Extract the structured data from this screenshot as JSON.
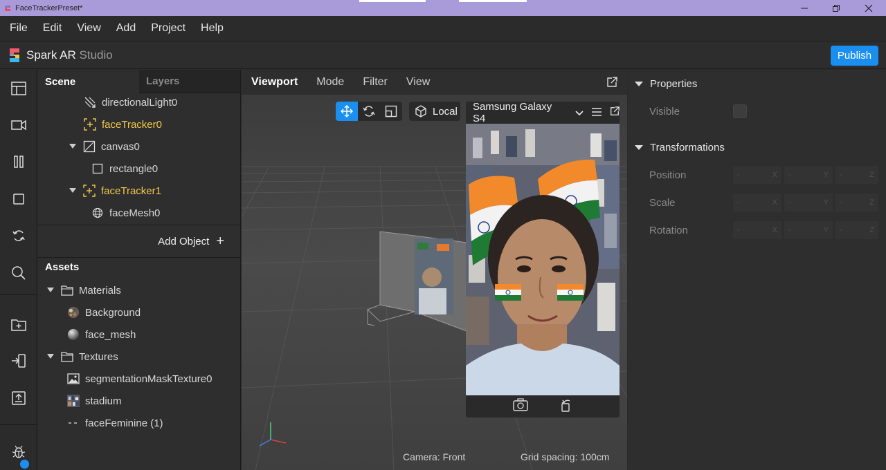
{
  "window": {
    "title": "FaceTrackerPreset*",
    "minimize": "—",
    "restore": "⧉",
    "close": "✕"
  },
  "menu": [
    "File",
    "Edit",
    "View",
    "Add",
    "Project",
    "Help"
  ],
  "brand": {
    "name": "Spark AR",
    "product": " Studio",
    "publish_label": "Publish"
  },
  "toolbar": {
    "icons": [
      "layout-icon",
      "video-icon",
      "pause-icon",
      "stop-icon",
      "refresh-icon",
      "search-icon",
      "import-icon",
      "device-link-icon",
      "upload-icon",
      "bug-icon"
    ]
  },
  "scene_panel": {
    "tabs": [
      "Scene",
      "Layers"
    ],
    "items": [
      {
        "label": "directionalLight0",
        "icon": "directional-light-icon",
        "highlight": false,
        "expanded": null
      },
      {
        "label": "faceTracker0",
        "icon": "face-tracker-icon",
        "highlight": true,
        "expanded": null
      },
      {
        "label": "canvas0",
        "icon": "canvas-icon",
        "highlight": false,
        "expanded": true
      },
      {
        "label": "rectangle0",
        "icon": "rectangle-icon",
        "highlight": false,
        "expanded": null
      },
      {
        "label": "faceTracker1",
        "icon": "face-tracker-icon",
        "highlight": true,
        "expanded": true
      },
      {
        "label": "faceMesh0",
        "icon": "face-mesh-icon",
        "highlight": false,
        "expanded": null
      }
    ],
    "add_object_label": "Add Object",
    "add_object_icon": "+"
  },
  "assets": {
    "title": "Assets",
    "groups": [
      {
        "label": "Materials",
        "children": [
          "Background",
          "face_mesh"
        ]
      },
      {
        "label": "Textures",
        "children": [
          "segmentationMaskTexture0",
          "stadium"
        ]
      }
    ],
    "extra_item": "faceFeminine (1)"
  },
  "viewport": {
    "tabs": [
      "Viewport",
      "Mode",
      "Filter",
      "View"
    ],
    "local_label": "Local",
    "device_name": "Samsung Galaxy S4",
    "camera_status": "Camera: Front",
    "grid_status": "Grid spacing:  100cm"
  },
  "properties": {
    "sections": [
      "Properties",
      "Transformations"
    ],
    "visible_label": "Visible",
    "rows": [
      "Position",
      "Scale",
      "Rotation"
    ],
    "axes": [
      "X",
      "Y",
      "Z"
    ],
    "field_placeholder": "-"
  },
  "colors": {
    "accent": "#1a8ff0",
    "highlight_text": "#f2c84b",
    "titlebar": "#a99bd9"
  }
}
